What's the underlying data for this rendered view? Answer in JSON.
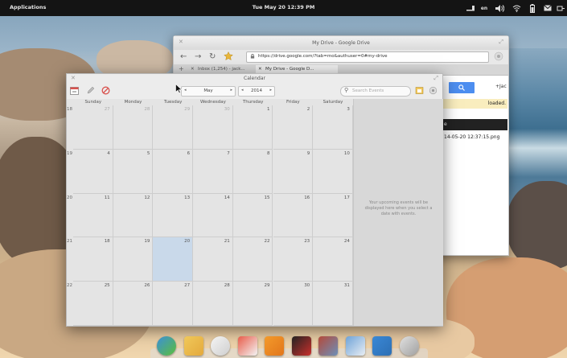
{
  "panel": {
    "apps_label": "Applications",
    "clock": "Tue May 20 12:39 PM",
    "keyboard": "en"
  },
  "browser": {
    "title": "My Drive - Google Drive",
    "url": "https://drive.google.com/?tab=mo&authuser=0#my-drive",
    "tabs": [
      {
        "label": "Inbox (1,254) - jack..."
      },
      {
        "label": "My Drive - Google D..."
      }
    ],
    "user": "+Jac",
    "notice": "loaded.",
    "darkbar_text": "e",
    "file": "14-05-20 12:37:15.png"
  },
  "calendar": {
    "title": "Calendar",
    "month": "May",
    "year": "2014",
    "search_placeholder": "Search Events",
    "days_of_week": [
      "Sunday",
      "Monday",
      "Tuesday",
      "Wednesday",
      "Thursday",
      "Friday",
      "Saturday"
    ],
    "week_numbers": [
      "18",
      "19",
      "20",
      "21",
      "22"
    ],
    "weeks": [
      [
        "27",
        "28",
        "29",
        "30",
        "1",
        "2",
        "3"
      ],
      [
        "4",
        "5",
        "6",
        "7",
        "8",
        "9",
        "10"
      ],
      [
        "11",
        "12",
        "13",
        "14",
        "15",
        "16",
        "17"
      ],
      [
        "18",
        "19",
        "20",
        "21",
        "22",
        "23",
        "24"
      ],
      [
        "25",
        "26",
        "27",
        "28",
        "29",
        "30",
        "31"
      ]
    ],
    "today": "20",
    "events_message": "Your upcoming events will be displayed here when you select a date with events."
  },
  "dock": [
    "midori-icon",
    "mail-icon",
    "notifications-icon",
    "calendar-icon",
    "music-icon",
    "videos-icon",
    "photos-icon",
    "files-icon",
    "downloads-icon",
    "settings-icon"
  ]
}
